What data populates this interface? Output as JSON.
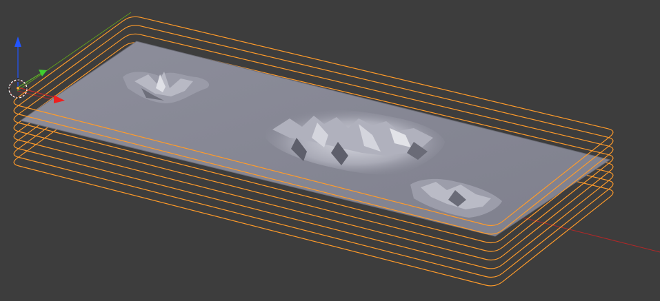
{
  "viewport": {
    "name": "3d-viewport",
    "background": "#3d3d3d"
  },
  "axes": {
    "x_color": "#c02a2a",
    "y_color": "#6aa521",
    "z_color": "#2255ff"
  },
  "selection": {
    "outline_color": "#ff9b2a",
    "outline_count": 8
  },
  "terrain": {
    "surface_color": "#8a8b98",
    "surface_light": "#a7a8b6",
    "mountain_highlight": "#d0d1da",
    "mountain_shadow": "#5f606c"
  },
  "cursor_3d": {
    "ring_color": "#ffffff",
    "dash_color": "#ff3b3b"
  },
  "icons": {
    "origin": "object-origin-icon",
    "cursor": "3d-cursor-icon"
  }
}
